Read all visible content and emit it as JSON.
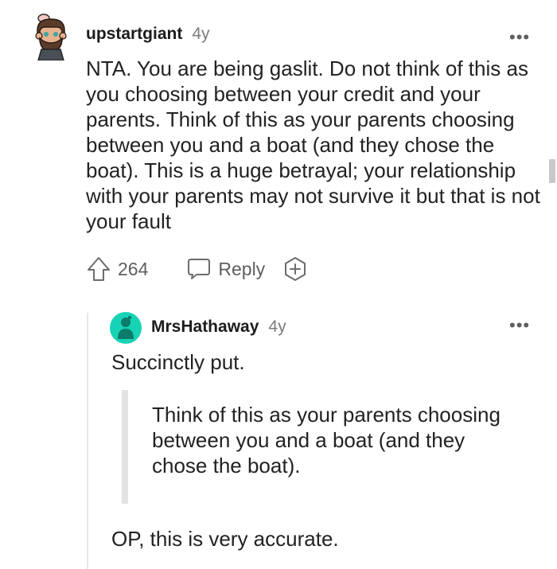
{
  "comment": {
    "username": "upstartgiant",
    "age": "4y",
    "more": "•••",
    "text": "NTA. You are being gaslit. Do not think of this as you choosing between your credit and your parents. Think of this as your parents choosing between you and a boat (and they chose the boat). This is a huge betrayal; your relationship with your parents may not survive it but that is not your fault",
    "upvotes": "264",
    "reply_label": "Reply"
  },
  "reply": {
    "username": "MrsHathaway",
    "age": "4y",
    "more": "•••",
    "text1": "Succinctly put.",
    "quote": "Think of this as your parents choosing between you and a boat (and they chose the boat).",
    "text2": "OP, this is very accurate."
  },
  "colors": {
    "avatar2_bg": "#17d3b6",
    "meta_gray": "#7c7c7c",
    "icon_gray": "#5f5f5f"
  },
  "icons": [
    "upvote-icon",
    "reply-icon",
    "award-icon",
    "more-icon"
  ]
}
